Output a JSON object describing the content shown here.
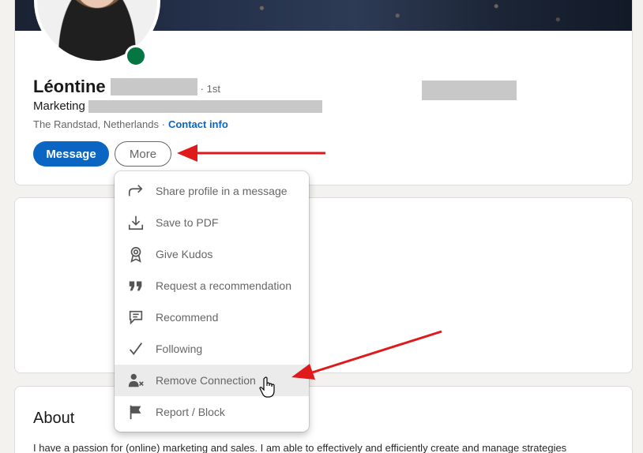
{
  "profile": {
    "first_name": "Léontine",
    "degree": "· 1st",
    "headline_prefix": "Marketing",
    "location": "The Randstad, Netherlands ·",
    "contact_link": "Contact info",
    "message_button": "Message",
    "more_button": "More",
    "presence_color": "#057642"
  },
  "more_menu": {
    "items": [
      {
        "label": "Share profile in a message",
        "icon": "share-arrow-icon"
      },
      {
        "label": "Save to PDF",
        "icon": "download-icon"
      },
      {
        "label": "Give Kudos",
        "icon": "award-ribbon-icon"
      },
      {
        "label": "Request a recommendation",
        "icon": "quote-icon"
      },
      {
        "label": "Recommend",
        "icon": "speech-bubble-icon"
      },
      {
        "label": "Following",
        "icon": "checkmark-icon"
      },
      {
        "label": "Remove Connection",
        "icon": "remove-person-icon",
        "hovered": true
      },
      {
        "label": "Report / Block",
        "icon": "flag-icon"
      }
    ]
  },
  "about": {
    "title": "About",
    "text": "I have a passion for (online) marketing and sales. I am able to effectively and efficiently create and manage strategies"
  },
  "colors": {
    "primary": "#0a66c2",
    "annotation_arrow": "#e0191b",
    "background": "#f3f2ef"
  }
}
